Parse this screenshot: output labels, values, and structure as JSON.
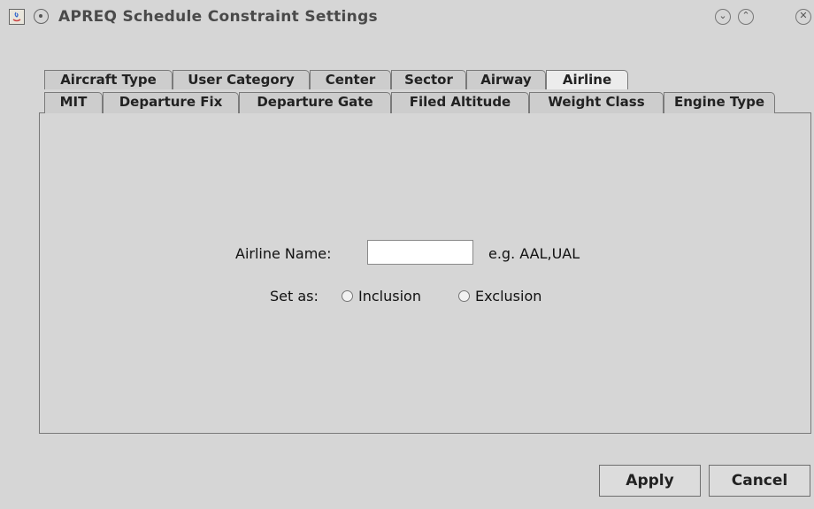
{
  "window": {
    "title": "APREQ Schedule Constraint Settings",
    "minimize_glyph": "⌄",
    "maximize_glyph": "⌃",
    "close_glyph": "✕"
  },
  "tabs_row1": [
    "Aircraft Type",
    "User Category",
    "Center",
    "Sector",
    "Airway",
    "Airline"
  ],
  "tabs_row2": [
    "MIT",
    "Departure Fix",
    "Departure Gate",
    "Filed Altitude",
    "Weight Class",
    "Engine Type"
  ],
  "selected_tab": "Airline",
  "form": {
    "airline_name_label": "Airline Name:",
    "airline_name_value": "",
    "example_text": "e.g. AAL,UAL",
    "set_as_label": "Set as:",
    "inclusion_label": "Inclusion",
    "exclusion_label": "Exclusion"
  },
  "buttons": {
    "apply": "Apply",
    "cancel": "Cancel"
  }
}
